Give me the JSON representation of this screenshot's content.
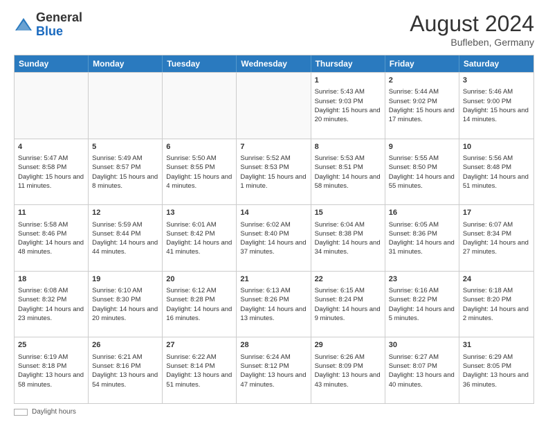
{
  "header": {
    "logo_general": "General",
    "logo_blue": "Blue",
    "month_year": "August 2024",
    "location": "Bufleben, Germany"
  },
  "days_of_week": [
    "Sunday",
    "Monday",
    "Tuesday",
    "Wednesday",
    "Thursday",
    "Friday",
    "Saturday"
  ],
  "footer": {
    "label": "Daylight hours"
  },
  "weeks": [
    [
      {
        "day": "",
        "info": ""
      },
      {
        "day": "",
        "info": ""
      },
      {
        "day": "",
        "info": ""
      },
      {
        "day": "",
        "info": ""
      },
      {
        "day": "1",
        "info": "Sunrise: 5:43 AM\nSunset: 9:03 PM\nDaylight: 15 hours and 20 minutes."
      },
      {
        "day": "2",
        "info": "Sunrise: 5:44 AM\nSunset: 9:02 PM\nDaylight: 15 hours and 17 minutes."
      },
      {
        "day": "3",
        "info": "Sunrise: 5:46 AM\nSunset: 9:00 PM\nDaylight: 15 hours and 14 minutes."
      }
    ],
    [
      {
        "day": "4",
        "info": "Sunrise: 5:47 AM\nSunset: 8:58 PM\nDaylight: 15 hours and 11 minutes."
      },
      {
        "day": "5",
        "info": "Sunrise: 5:49 AM\nSunset: 8:57 PM\nDaylight: 15 hours and 8 minutes."
      },
      {
        "day": "6",
        "info": "Sunrise: 5:50 AM\nSunset: 8:55 PM\nDaylight: 15 hours and 4 minutes."
      },
      {
        "day": "7",
        "info": "Sunrise: 5:52 AM\nSunset: 8:53 PM\nDaylight: 15 hours and 1 minute."
      },
      {
        "day": "8",
        "info": "Sunrise: 5:53 AM\nSunset: 8:51 PM\nDaylight: 14 hours and 58 minutes."
      },
      {
        "day": "9",
        "info": "Sunrise: 5:55 AM\nSunset: 8:50 PM\nDaylight: 14 hours and 55 minutes."
      },
      {
        "day": "10",
        "info": "Sunrise: 5:56 AM\nSunset: 8:48 PM\nDaylight: 14 hours and 51 minutes."
      }
    ],
    [
      {
        "day": "11",
        "info": "Sunrise: 5:58 AM\nSunset: 8:46 PM\nDaylight: 14 hours and 48 minutes."
      },
      {
        "day": "12",
        "info": "Sunrise: 5:59 AM\nSunset: 8:44 PM\nDaylight: 14 hours and 44 minutes."
      },
      {
        "day": "13",
        "info": "Sunrise: 6:01 AM\nSunset: 8:42 PM\nDaylight: 14 hours and 41 minutes."
      },
      {
        "day": "14",
        "info": "Sunrise: 6:02 AM\nSunset: 8:40 PM\nDaylight: 14 hours and 37 minutes."
      },
      {
        "day": "15",
        "info": "Sunrise: 6:04 AM\nSunset: 8:38 PM\nDaylight: 14 hours and 34 minutes."
      },
      {
        "day": "16",
        "info": "Sunrise: 6:05 AM\nSunset: 8:36 PM\nDaylight: 14 hours and 31 minutes."
      },
      {
        "day": "17",
        "info": "Sunrise: 6:07 AM\nSunset: 8:34 PM\nDaylight: 14 hours and 27 minutes."
      }
    ],
    [
      {
        "day": "18",
        "info": "Sunrise: 6:08 AM\nSunset: 8:32 PM\nDaylight: 14 hours and 23 minutes."
      },
      {
        "day": "19",
        "info": "Sunrise: 6:10 AM\nSunset: 8:30 PM\nDaylight: 14 hours and 20 minutes."
      },
      {
        "day": "20",
        "info": "Sunrise: 6:12 AM\nSunset: 8:28 PM\nDaylight: 14 hours and 16 minutes."
      },
      {
        "day": "21",
        "info": "Sunrise: 6:13 AM\nSunset: 8:26 PM\nDaylight: 14 hours and 13 minutes."
      },
      {
        "day": "22",
        "info": "Sunrise: 6:15 AM\nSunset: 8:24 PM\nDaylight: 14 hours and 9 minutes."
      },
      {
        "day": "23",
        "info": "Sunrise: 6:16 AM\nSunset: 8:22 PM\nDaylight: 14 hours and 5 minutes."
      },
      {
        "day": "24",
        "info": "Sunrise: 6:18 AM\nSunset: 8:20 PM\nDaylight: 14 hours and 2 minutes."
      }
    ],
    [
      {
        "day": "25",
        "info": "Sunrise: 6:19 AM\nSunset: 8:18 PM\nDaylight: 13 hours and 58 minutes."
      },
      {
        "day": "26",
        "info": "Sunrise: 6:21 AM\nSunset: 8:16 PM\nDaylight: 13 hours and 54 minutes."
      },
      {
        "day": "27",
        "info": "Sunrise: 6:22 AM\nSunset: 8:14 PM\nDaylight: 13 hours and 51 minutes."
      },
      {
        "day": "28",
        "info": "Sunrise: 6:24 AM\nSunset: 8:12 PM\nDaylight: 13 hours and 47 minutes."
      },
      {
        "day": "29",
        "info": "Sunrise: 6:26 AM\nSunset: 8:09 PM\nDaylight: 13 hours and 43 minutes."
      },
      {
        "day": "30",
        "info": "Sunrise: 6:27 AM\nSunset: 8:07 PM\nDaylight: 13 hours and 40 minutes."
      },
      {
        "day": "31",
        "info": "Sunrise: 6:29 AM\nSunset: 8:05 PM\nDaylight: 13 hours and 36 minutes."
      }
    ]
  ]
}
